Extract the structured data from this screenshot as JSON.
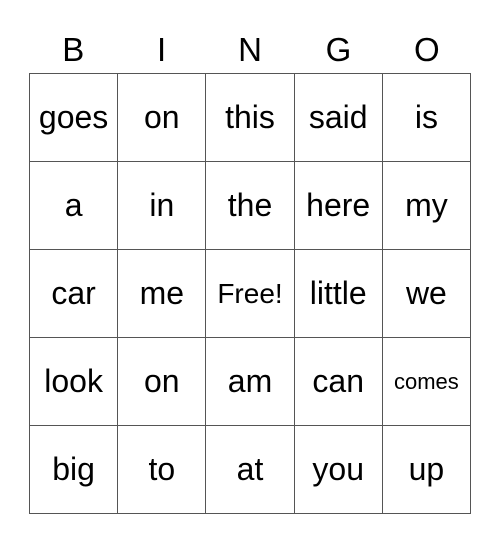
{
  "card": {
    "header": [
      "B",
      "I",
      "N",
      "G",
      "O"
    ],
    "rows": [
      [
        "goes",
        "on",
        "this",
        "said",
        "is"
      ],
      [
        "a",
        "in",
        "the",
        "here",
        "my"
      ],
      [
        "car",
        "me",
        "Free!",
        "little",
        "we"
      ],
      [
        "look",
        "on",
        "am",
        "can",
        "comes"
      ],
      [
        "big",
        "to",
        "at",
        "you",
        "up"
      ]
    ]
  }
}
